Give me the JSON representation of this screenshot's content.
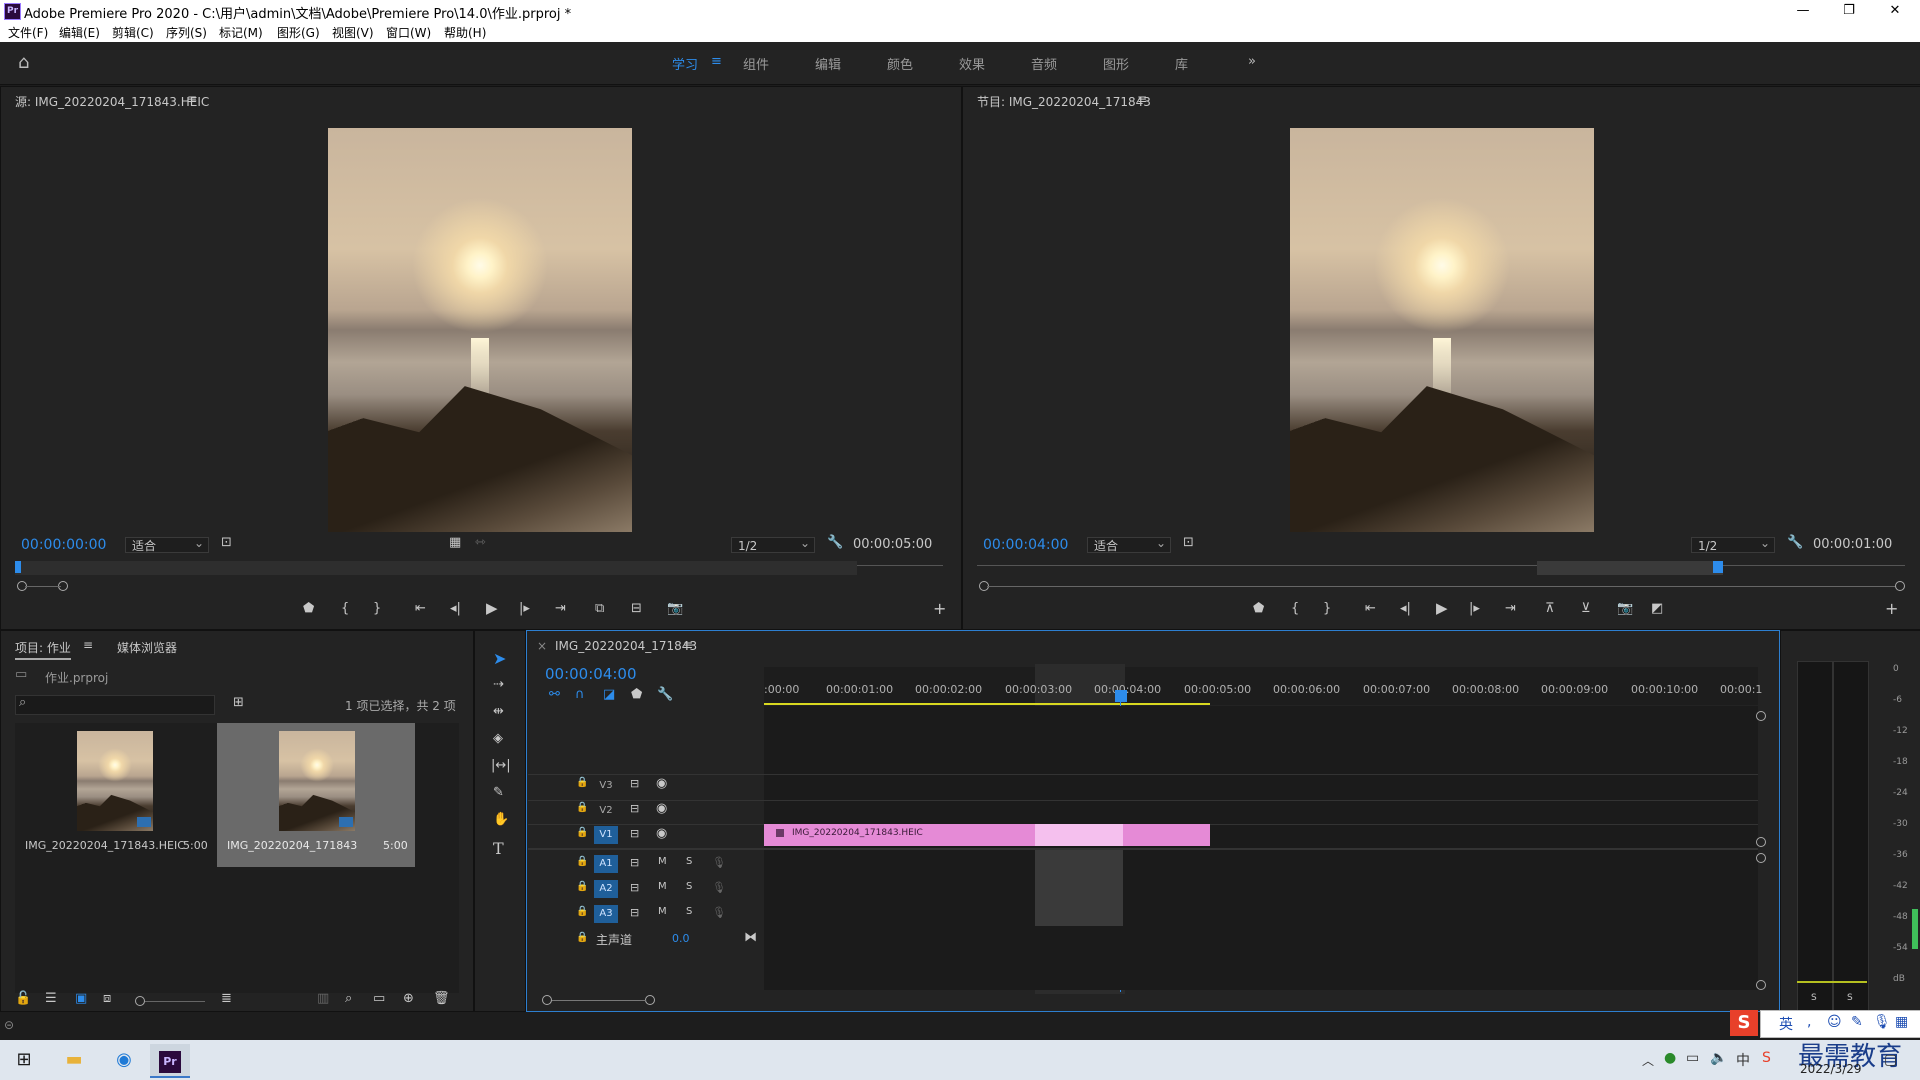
{
  "titlebar": {
    "text": "Adobe Premiere Pro 2020 - C:\\用户\\admin\\文档\\Adobe\\Premiere Pro\\14.0\\作业.prproj *",
    "minimize": "—",
    "restore": "❐",
    "close": "✕"
  },
  "menu": [
    "文件(F)",
    "编辑(E)",
    "剪辑(C)",
    "序列(S)",
    "标记(M)",
    "图形(G)",
    "视图(V)",
    "窗口(W)",
    "帮助(H)"
  ],
  "workspaces": [
    "学习",
    "组件",
    "编辑",
    "颜色",
    "效果",
    "音频",
    "图形",
    "库"
  ],
  "source": {
    "title": "源: IMG_20220204_171843.HEIC",
    "timecode": "00:00:00:00",
    "fit": "适合",
    "resolution": "1/2",
    "duration": "00:00:05:00"
  },
  "program": {
    "title": "节目: IMG_20220204_171843",
    "timecode": "00:00:04:00",
    "fit": "适合",
    "resolution": "1/2",
    "duration": "00:00:01:00"
  },
  "project": {
    "tab_project": "项目: 作业",
    "tab_media": "媒体浏览器",
    "file": "作业.prproj",
    "selection": "1 项已选择，共 2 项",
    "items": [
      {
        "name": "IMG_20220204_171843.HEIC",
        "duration": "5:00"
      },
      {
        "name": "IMG_20220204_171843",
        "duration": "5:00"
      }
    ]
  },
  "timeline": {
    "tab": "IMG_20220204_171843",
    "close": "×",
    "timecode": "00:00:04:00",
    "ticks": [
      ":00:00",
      "00:00:01:00",
      "00:00:02:00",
      "00:00:03:00",
      "00:00:04:00",
      "00:00:05:00",
      "00:00:06:00",
      "00:00:07:00",
      "00:00:08:00",
      "00:00:09:00",
      "00:00:10:00",
      "00:00:1"
    ],
    "video_tracks": [
      "V3",
      "V2",
      "V1"
    ],
    "audio_tracks": [
      "A1",
      "A2",
      "A3"
    ],
    "mute": "M",
    "solo": "S",
    "master": "主声道",
    "master_value": "0.0",
    "clip": "IMG_20220204_171843.HEIC"
  },
  "meter": {
    "labels": [
      "0",
      "-6",
      "-12",
      "-18",
      "-24",
      "-30",
      "-36",
      "-42",
      "-48",
      "-54",
      "dB"
    ],
    "solo": "S"
  },
  "taskbar": {
    "ime": "英",
    "date": "2022/3/29",
    "watermark": "最需教育"
  }
}
